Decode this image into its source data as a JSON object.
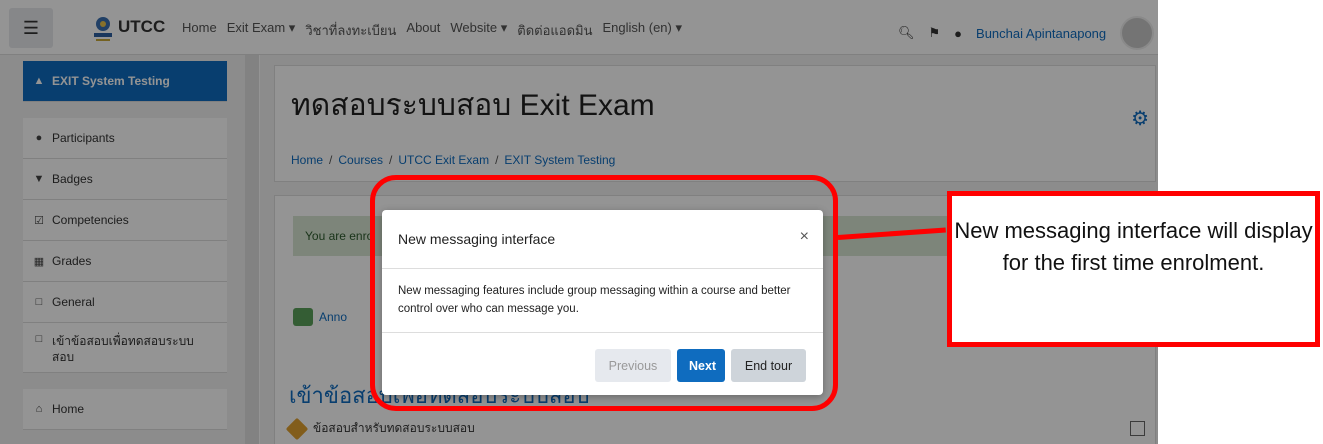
{
  "navbar": {
    "brand": "UTCC",
    "links": [
      "Home",
      "Exit Exam ▾",
      "วิชาที่ลงทะเบียน",
      "About",
      "Website ▾",
      "ติดต่อแอดมิน",
      "English (en) ▾"
    ],
    "user_name": "Bunchai Apintanapong"
  },
  "drawer": {
    "items": [
      {
        "label": "EXIT System Testing",
        "icon": "graduation-cap-icon",
        "active": true
      },
      {
        "label": "Participants",
        "icon": "users-icon"
      },
      {
        "label": "Badges",
        "icon": "shield-icon"
      },
      {
        "label": "Competencies",
        "icon": "check-square-icon"
      },
      {
        "label": "Grades",
        "icon": "table-icon"
      },
      {
        "label": "General",
        "icon": "folder-icon"
      },
      {
        "label": "เข้าข้อสอบเพื่อทดสอบระบบสอบ",
        "icon": "folder-icon"
      },
      {
        "label": "Home",
        "icon": "home-icon"
      }
    ]
  },
  "page": {
    "title": "ทดสอบระบบสอบ Exit Exam",
    "breadcrumb": [
      "Home",
      "Courses",
      "UTCC Exit Exam",
      "EXIT System Testing"
    ],
    "alert_text": "You are enro",
    "forum_link": "Anno",
    "section_title": "เข้าข้อสอบเพื่อทดสอบระบบสอบ",
    "quiz_link": "ข้อสอบสำหรับทดสอบระบบสอบ"
  },
  "modal": {
    "title": "New messaging interface",
    "close": "×",
    "body": "New messaging features include group messaging within a course and better control over who can message you.",
    "buttons": {
      "previous": "Previous",
      "next": "Next",
      "end": "End tour"
    }
  },
  "annotation": {
    "callout_text": "New messaging interface will display for the first time enrolment.",
    "color": "#ff0000"
  }
}
